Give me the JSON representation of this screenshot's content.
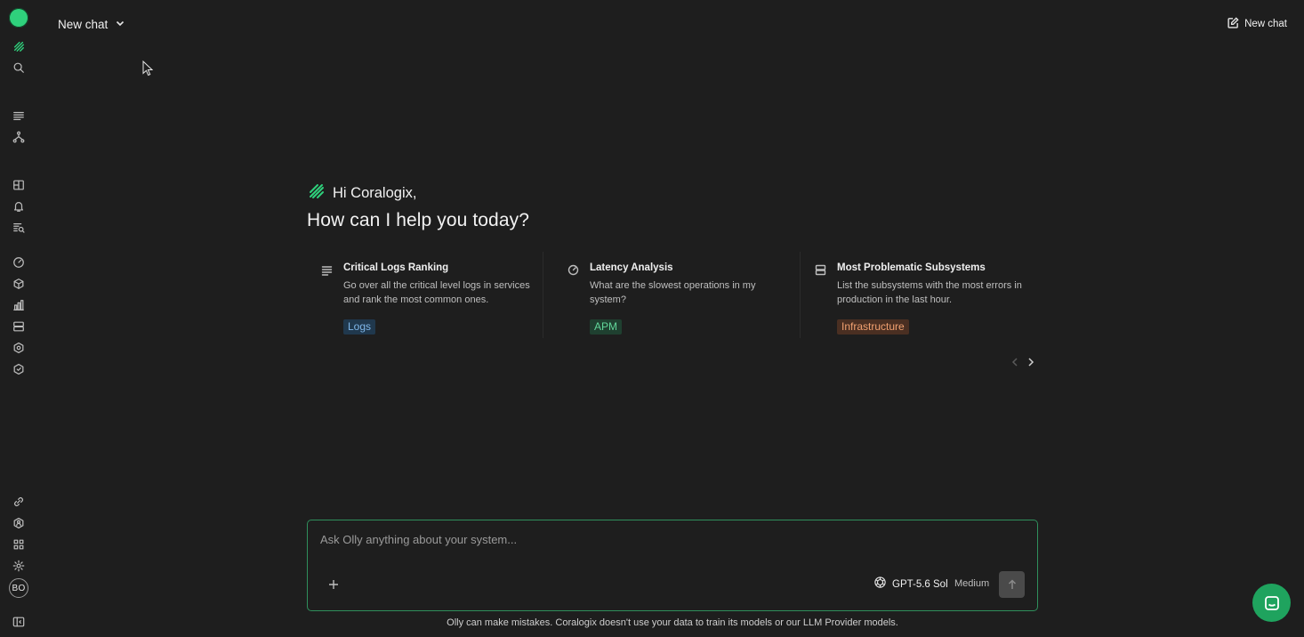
{
  "header": {
    "chat_title": "New chat",
    "new_chat_label": "New chat"
  },
  "sidebar": {
    "status_color": "#2fd17c",
    "items": [
      {
        "name": "coralogix-logo-icon"
      },
      {
        "name": "search-icon"
      },
      {
        "name": "logs-icon"
      },
      {
        "name": "service-map-icon"
      },
      {
        "name": "dashboards-icon"
      },
      {
        "name": "alerts-icon"
      },
      {
        "name": "explore-icon"
      },
      {
        "name": "apm-gauge-icon"
      },
      {
        "name": "rum-cube-icon"
      },
      {
        "name": "metrics-chart-icon"
      },
      {
        "name": "infrastructure-icon"
      },
      {
        "name": "security-hex-icon"
      },
      {
        "name": "shield-icon"
      },
      {
        "name": "integrations-icon"
      },
      {
        "name": "user-access-icon"
      },
      {
        "name": "apps-grid-icon"
      },
      {
        "name": "settings-icon"
      }
    ],
    "avatar_initials": "BO",
    "collapse_icon": "sidebar-toggle-icon"
  },
  "greeting": {
    "hi": "Hi Coralogix,",
    "question": "How can I help you today?"
  },
  "cards": [
    {
      "icon": "lines-icon",
      "title": "Critical Logs Ranking",
      "description": "Go over all the critical level logs in services and rank the most common ones.",
      "tag": "Logs",
      "tag_color": "#7fb6e8"
    },
    {
      "icon": "gauge-icon",
      "title": "Latency Analysis",
      "description": "What are the slowest operations in my system?",
      "tag": "APM",
      "tag_color": "#62d69a"
    },
    {
      "icon": "server-icon",
      "title": "Most Problematic Subsystems",
      "description": "List the subsystems with the most errors in production in the last hour.",
      "tag": "Infrastructure",
      "tag_color": "#f0a070"
    }
  ],
  "composer": {
    "placeholder": "Ask Olly anything about your system...",
    "model": "GPT-5.6 Sol",
    "effort": "Medium"
  },
  "disclaimer": "Olly can make mistakes. Coralogix doesn't use your data to train its models or our LLM Provider models.",
  "colors": {
    "background": "#1e1e1e",
    "accent_green": "#2f8f5c",
    "chat_bubble": "#1fa35e"
  }
}
